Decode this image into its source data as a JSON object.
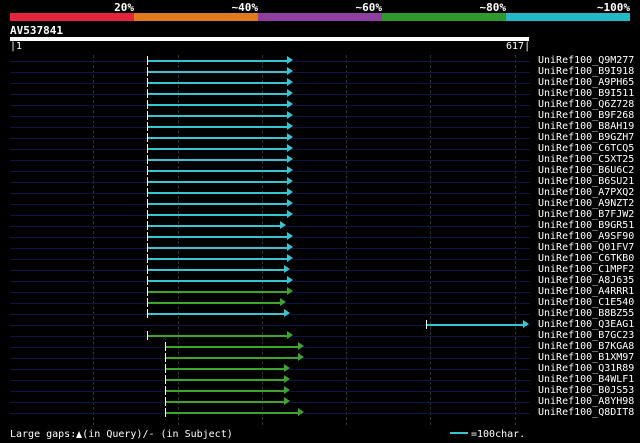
{
  "colors": {
    "background": "#000000",
    "cyan": "#34c6d2",
    "green": "#3aa72a",
    "baseline": "#0b1646",
    "scale": [
      "#e5243b",
      "#e07a1b",
      "#8e3fa0",
      "#2e9a2e",
      "#22b8c5"
    ]
  },
  "scale_labels": [
    "20%",
    "~40%",
    "~60%",
    "~80%",
    "~100%"
  ],
  "query": {
    "name": "AV537841",
    "start": "1",
    "end": "617"
  },
  "hits": [
    {
      "name": "UniRef100_Q9M277",
      "start": 164,
      "end": 337,
      "color": "cyan"
    },
    {
      "name": "UniRef100_B9I918",
      "start": 164,
      "end": 337,
      "color": "cyan"
    },
    {
      "name": "UniRef100_A9PH65",
      "start": 164,
      "end": 337,
      "color": "cyan"
    },
    {
      "name": "UniRef100_B9I511",
      "start": 164,
      "end": 337,
      "color": "cyan"
    },
    {
      "name": "UniRef100_Q6Z728",
      "start": 164,
      "end": 337,
      "color": "cyan"
    },
    {
      "name": "UniRef100_B9F268",
      "start": 164,
      "end": 337,
      "color": "cyan"
    },
    {
      "name": "UniRef100_B8AH19",
      "start": 164,
      "end": 337,
      "color": "cyan"
    },
    {
      "name": "UniRef100_B9GZH7",
      "start": 164,
      "end": 337,
      "color": "cyan"
    },
    {
      "name": "UniRef100_C6TCQ5",
      "start": 164,
      "end": 337,
      "color": "cyan"
    },
    {
      "name": "UniRef100_C5XT25",
      "start": 164,
      "end": 337,
      "color": "cyan"
    },
    {
      "name": "UniRef100_B6U6C2",
      "start": 164,
      "end": 337,
      "color": "cyan"
    },
    {
      "name": "UniRef100_B6SU21",
      "start": 164,
      "end": 337,
      "color": "cyan"
    },
    {
      "name": "UniRef100_A7PXQ2",
      "start": 164,
      "end": 337,
      "color": "cyan"
    },
    {
      "name": "UniRef100_A9NZT2",
      "start": 164,
      "end": 337,
      "color": "cyan"
    },
    {
      "name": "UniRef100_B7FJW2",
      "start": 164,
      "end": 337,
      "color": "cyan"
    },
    {
      "name": "UniRef100_B9GR51",
      "start": 164,
      "end": 329,
      "color": "cyan"
    },
    {
      "name": "UniRef100_A9SF90",
      "start": 164,
      "end": 337,
      "color": "cyan"
    },
    {
      "name": "UniRef100_Q01FV7",
      "start": 164,
      "end": 337,
      "color": "cyan"
    },
    {
      "name": "UniRef100_C6TKB0",
      "start": 164,
      "end": 337,
      "color": "cyan"
    },
    {
      "name": "UniRef100_C1MPF2",
      "start": 164,
      "end": 333,
      "color": "cyan"
    },
    {
      "name": "UniRef100_A8J635",
      "start": 164,
      "end": 337,
      "color": "cyan"
    },
    {
      "name": "UniRef100_A4RRR1",
      "start": 164,
      "end": 337,
      "color": "green"
    },
    {
      "name": "UniRef100_C1E540",
      "start": 164,
      "end": 329,
      "color": "green"
    },
    {
      "name": "UniRef100_B8BZ55",
      "start": 164,
      "end": 333,
      "color": "cyan"
    },
    {
      "name": "UniRef100_Q3EAG1",
      "start": 495,
      "end": 617,
      "color": "cyan"
    },
    {
      "name": "UniRef100_B7GC23",
      "start": 164,
      "end": 337,
      "color": "green"
    },
    {
      "name": "UniRef100_B7KGA8",
      "start": 185,
      "end": 350,
      "color": "green"
    },
    {
      "name": "UniRef100_B1XM97",
      "start": 185,
      "end": 350,
      "color": "green"
    },
    {
      "name": "UniRef100_Q31R89",
      "start": 185,
      "end": 333,
      "color": "green"
    },
    {
      "name": "UniRef100_B4WLF1",
      "start": 185,
      "end": 333,
      "color": "green"
    },
    {
      "name": "UniRef100_B0JS53",
      "start": 185,
      "end": 333,
      "color": "green"
    },
    {
      "name": "UniRef100_A8YH98",
      "start": 185,
      "end": 333,
      "color": "green"
    },
    {
      "name": "UniRef100_Q8DIT8",
      "start": 185,
      "end": 350,
      "color": "green"
    }
  ],
  "legend": {
    "gaps_prefix": "Large gaps:",
    "gaps_suffix": "(in Query)/- (in Subject)",
    "scale_text": "=100char."
  }
}
